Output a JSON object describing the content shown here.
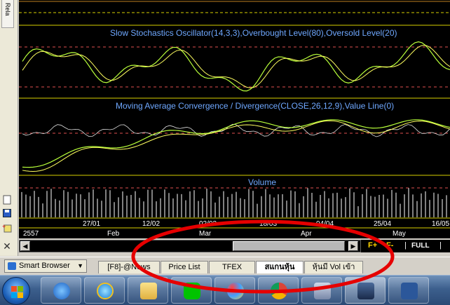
{
  "side_tab_label": "Rela",
  "chart": {
    "stochastics_title": "Slow Stochastics Oscillator(14,3,3),Overbought Level(80),Oversold Level(20)",
    "macd_title": "Moving Average Convergence / Divergence(CLOSE,26,12,9),Value Line(0)",
    "volume_title": "Volume",
    "date_labels": [
      "27/01",
      "12/02",
      "02/03",
      "18/03",
      "04/04",
      "25/04",
      "16/05"
    ],
    "month_labels": [
      "2557",
      "Feb",
      "Mar",
      "Apr",
      "May"
    ],
    "colors": {
      "background": "#000000",
      "title": "#6fa8ff",
      "grid_yellow": "#d8d000",
      "dashed_level": "#e05050",
      "line_green": "#b8ff3a",
      "line_yellow": "#ffff60",
      "line_white": "#e0e0e0",
      "volume_bar": "#ffffff",
      "annotation": "#e60000"
    }
  },
  "scrollbar": {
    "left_arrow": "◀",
    "right_arrow": "▶"
  },
  "zoom": {
    "zoom_in": "F+",
    "zoom_out": "F-",
    "full": "FULL",
    "sep": "|"
  },
  "tabbar": {
    "smart_browser": "Smart Browser",
    "tabs": [
      "[F8]-@News",
      "Price List",
      "TFEX",
      "สแกนหุ้น",
      "หุ้นมี Vol เข้า"
    ],
    "active_tab": 3
  },
  "taskbar": {
    "icons": [
      "start-orb-icon",
      "speed-app-icon",
      "internet-explorer-icon",
      "file-explorer-icon",
      "line-app-icon",
      "paint-icon",
      "chrome-icon",
      "stock-app-icon",
      "chart-app-icon",
      "word-icon"
    ]
  }
}
